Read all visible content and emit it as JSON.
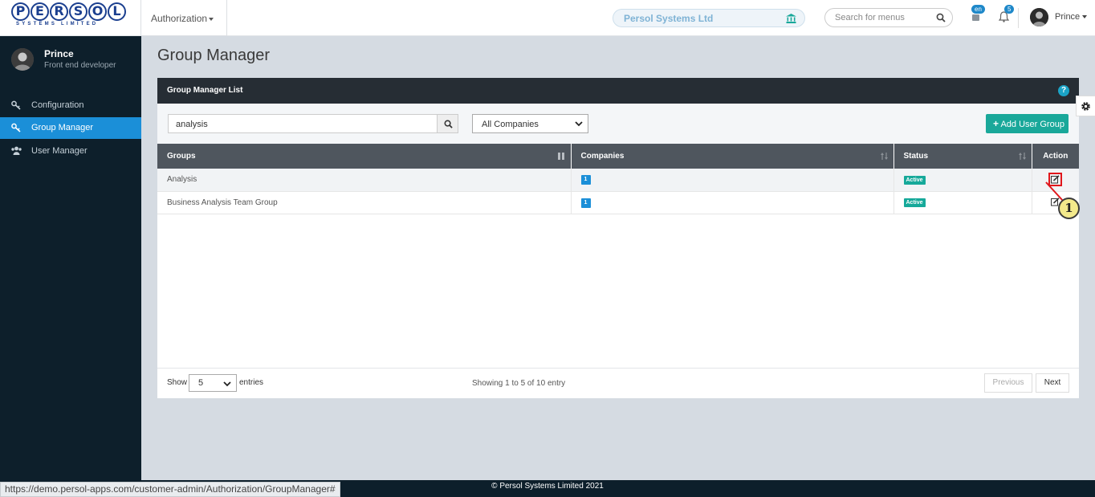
{
  "brand": {
    "logo_letters": [
      "P",
      "E",
      "R",
      "S",
      "O",
      "L"
    ],
    "logo_sub": "SYSTEMS LIMITED",
    "primary_color": "#1b3f8f"
  },
  "header": {
    "module": "Authorization",
    "company": "Persol Systems Ltd",
    "search_placeholder": "Search for menus",
    "language_badge": "en",
    "notification_count": "5",
    "username": "Prince"
  },
  "sidebar": {
    "profile_name": "Prince",
    "profile_role": "Front end developer",
    "items": [
      {
        "label": "Configuration",
        "icon": "key-icon"
      },
      {
        "label": "Group Manager",
        "icon": "key-icon",
        "active": true
      },
      {
        "label": "User Manager",
        "icon": "users-icon"
      }
    ],
    "active_color": "#1b8fd8"
  },
  "main": {
    "page_title": "Group Manager",
    "card_title": "Group Manager List",
    "help": "?",
    "filter_value": "analysis",
    "company_filter": "All Companies",
    "add_button": "Add User Group",
    "table": {
      "headers": [
        "Groups",
        "Companies",
        "Status",
        "Action"
      ],
      "rows": [
        {
          "group": "Analysis",
          "companies": "1",
          "status": "Active"
        },
        {
          "group": "Business Analysis Team Group",
          "companies": "1",
          "status": "Active"
        }
      ]
    },
    "footer": {
      "show_label": "Show",
      "page_size": "5",
      "entries_label": "entries",
      "showing": "Showing 1 to 5 of 10 entry",
      "previous": "Previous",
      "next": "Next"
    }
  },
  "annotation": {
    "step": "1"
  },
  "page_footer": "© Persol Systems Limited 2021",
  "status_url": "https://demo.persol-apps.com/customer-admin/Authorization/GroupManager#"
}
